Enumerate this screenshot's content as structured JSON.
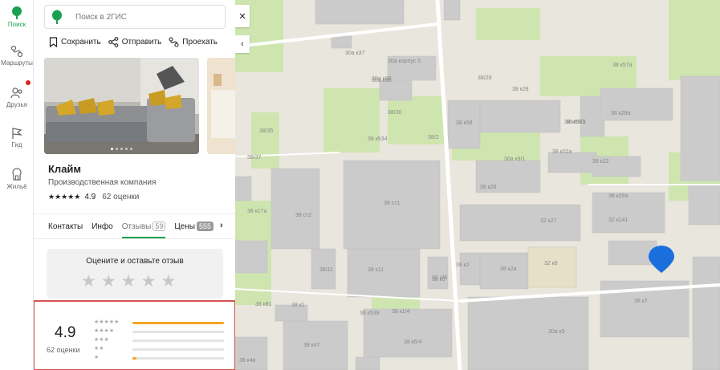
{
  "nav": [
    {
      "label": "Поиск",
      "icon": "search-leaf-icon",
      "active": true
    },
    {
      "label": "Маршруты",
      "icon": "routes-icon"
    },
    {
      "label": "Друзья",
      "icon": "friends-icon",
      "notification": true
    },
    {
      "label": "Гид",
      "icon": "guide-flag-icon"
    },
    {
      "label": "Жильё",
      "icon": "housing-icon"
    }
  ],
  "search": {
    "placeholder": "Поиск в 2ГИС"
  },
  "actions": {
    "save": "Сохранить",
    "share": "Отправить",
    "route": "Проехать"
  },
  "org": {
    "name": "Клайм",
    "type": "Производственная компания",
    "rating": "4.9",
    "ratings_count": "62 оценки"
  },
  "tabs": [
    {
      "label": "Контакты"
    },
    {
      "label": "Инфо"
    },
    {
      "label": "Отзывы",
      "badge": "59",
      "active": true
    },
    {
      "label": "Цены",
      "badge": "555"
    }
  ],
  "rate": {
    "title": "Оцените и оставьте отзыв"
  },
  "summary": {
    "rating": "4.9",
    "count": "62 оценки",
    "distribution": [
      {
        "stars": 5,
        "fraction": 1.0
      },
      {
        "stars": 4,
        "fraction": 0.0
      },
      {
        "stars": 3,
        "fraction": 0.0
      },
      {
        "stars": 2,
        "fraction": 0.0
      },
      {
        "stars": 1,
        "fraction": 0.04
      }
    ]
  },
  "map": {
    "labels": [
      "30а к37",
      "30а корпус 5",
      "30а к30",
      "30а к56",
      "38/29",
      "38 к28",
      "38 к57а",
      "38 к58",
      "38/30",
      "38 к59/1",
      "38 к28а",
      "38 к593",
      "38/35",
      "38 к534",
      "38/37",
      "38 к22",
      "38 к22а",
      "30а к9/1",
      "38/2",
      "38 к26",
      "38 к29а",
      "38 ст2",
      "38 к17а",
      "38 ст1",
      "32 к27",
      "32 к141",
      "38 к2",
      "38 к9",
      "38 к2а",
      "32 к6",
      "38/11",
      "38 к11",
      "38 с/8",
      "38 к1",
      "38 к81",
      "38 к539",
      "38 к1/4",
      "38 к7",
      "38 к47",
      "38 к5/4",
      "30а к3",
      "38 к4в"
    ]
  },
  "colors": {
    "brand_green": "#1aa051",
    "pin_blue": "#1a6fdc",
    "highlight_red": "#d9534f",
    "star_orange": "#f5a623"
  }
}
